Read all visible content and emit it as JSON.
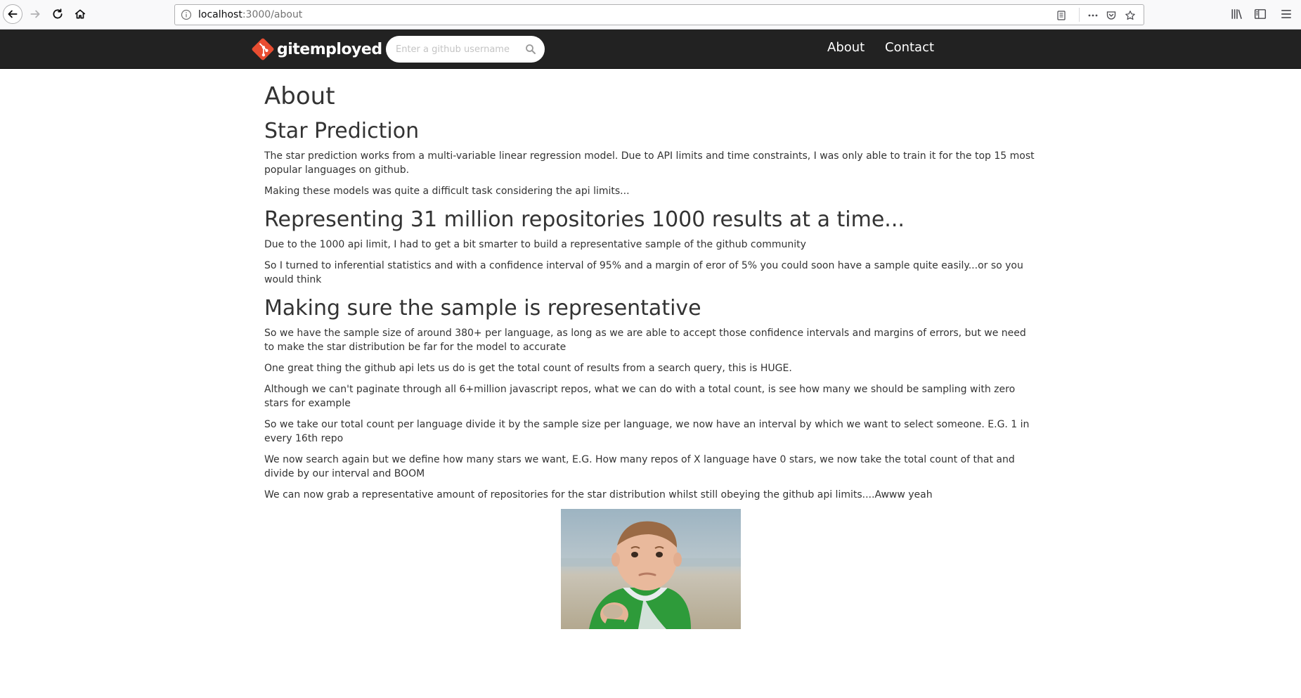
{
  "browser": {
    "url_host": "localhost",
    "url_path": ":3000/about"
  },
  "navbar": {
    "brand": "gitemployed",
    "search_placeholder": "Enter a github username",
    "links": [
      "About",
      "Contact"
    ]
  },
  "main": {
    "title": "About",
    "sections": [
      {
        "heading": "Star Prediction",
        "paragraphs": [
          "The star prediction works from a multi-variable linear regression model. Due to API limits and time constraints, I was only able to train it for the top 15 most popular languages on github.",
          "Making these models was quite a difficult task considering the api limits..."
        ]
      },
      {
        "heading": "Representing 31 million repositories 1000 results at a time...",
        "paragraphs": [
          "Due to the 1000 api limit, I had to get a bit smarter to build a representative sample of the github community",
          "So I turned to inferential statistics and with a confidence interval of 95% and a margin of eror of 5% you could soon have a sample quite easily...or so you would think"
        ]
      },
      {
        "heading": "Making sure the sample is representative",
        "paragraphs": [
          "So we have the sample size of around 380+ per language, as long as we are able to accept those confidence intervals and margins of errors, but we need to make the star distribution be far for the model to accurate",
          "One great thing the github api lets us do is get the total count of results from a search query, this is HUGE.",
          "Although we can't paginate through all 6+million javascript repos, what we can do with a total count, is see how many we should be sampling with zero stars for example",
          "So we take our total count per language divide it by the sample size per language, we now have an interval by which we want to select someone. E.G. 1 in every 16th repo",
          "We now search again but we define how many stars we want, E.G. How many repos of X language have 0 stars, we now take the total count of that and divide by our interval and BOOM",
          "We can now grab a representative amount of repositories for the star distribution whilst still obeying the github api limits....Awww yeah"
        ]
      }
    ]
  },
  "colors": {
    "navbar_bg": "#222222",
    "logo_red": "#e84d31",
    "text": "#333333"
  }
}
